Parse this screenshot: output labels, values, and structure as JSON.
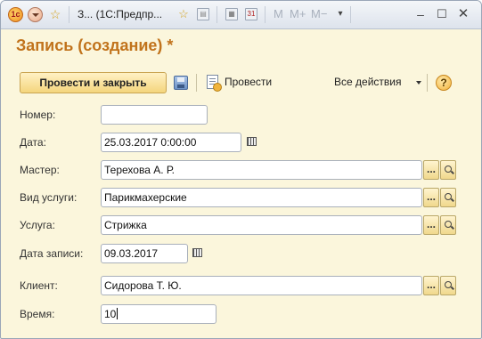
{
  "titlebar": {
    "title": "З... (1С:Предпр..."
  },
  "form": {
    "title": "Запись (создание) *"
  },
  "toolbar": {
    "post_and_close_label": "Провести и закрыть",
    "post_label": "Провести",
    "all_actions_label": "Все действия",
    "help_label": "?"
  },
  "fields": {
    "number": {
      "label": "Номер:",
      "value": ""
    },
    "date": {
      "label": "Дата:",
      "value": "25.03.2017  0:00:00"
    },
    "master": {
      "label": "Мастер:",
      "value": "Терехова А. Р."
    },
    "service_type": {
      "label": "Вид услуги:",
      "value": "Парикмахерские"
    },
    "service": {
      "label": "Услуга:",
      "value": "Стрижка"
    },
    "record_date": {
      "label": "Дата записи:",
      "value": "09.03.2017"
    },
    "client": {
      "label": "Клиент:",
      "value": "Сидорова Т. Ю."
    },
    "time": {
      "label": "Время:",
      "value": "10"
    }
  },
  "icons": {
    "ellipsis_glyph": "...",
    "m_labels": [
      "M",
      "M+",
      "M−"
    ]
  },
  "colors": {
    "form_background": "#fbf6dc",
    "title_color": "#c1731c",
    "primary_button": "#f4d57d"
  }
}
